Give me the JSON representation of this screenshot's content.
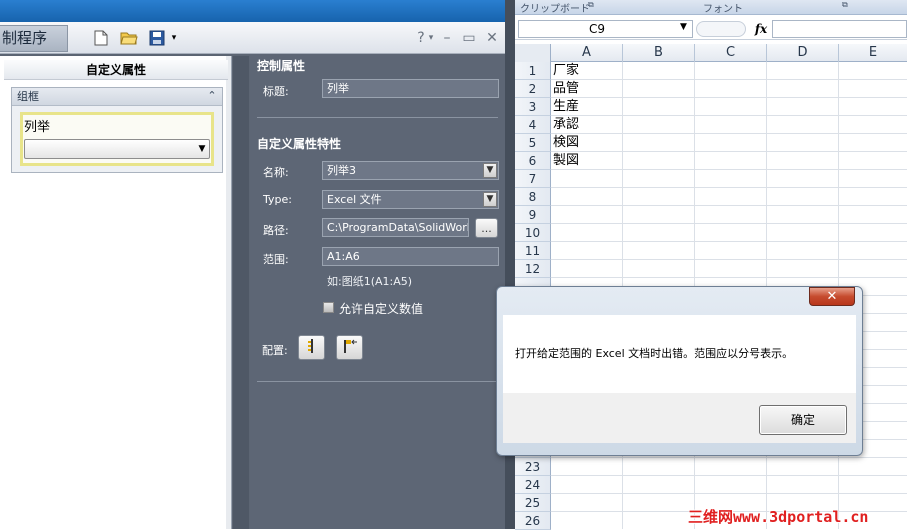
{
  "editor": {
    "app_tab_label": "制程序",
    "designer_title": "自定义属性",
    "group_label": "组框",
    "list_field_label": "列举",
    "help_button": "?",
    "control_section": {
      "title": "控制属性",
      "caption_label": "标题:",
      "caption_value": "列举"
    },
    "property_section": {
      "title": "自定义属性特性",
      "name_label": "名称:",
      "name_value": "列举3",
      "type_label": "Type:",
      "type_value": "Excel 文件",
      "path_label": "路径:",
      "path_value": "C:\\ProgramData\\SolidWorks\\",
      "browse_label": "...",
      "range_label": "范围:",
      "range_value": "A1:A6",
      "range_hint": "如:图纸1(A1:A5)",
      "allow_custom_label": "允许自定义数值",
      "config_label": "配置:"
    }
  },
  "excel": {
    "ribbon_groups": [
      "クリップボード",
      "フォント"
    ],
    "name_box": "C9",
    "fx_label": "fx",
    "columns": [
      "A",
      "B",
      "C",
      "D",
      "E"
    ],
    "rows": [
      "1",
      "2",
      "3",
      "4",
      "5",
      "6",
      "7",
      "8",
      "9",
      "10",
      "11",
      "12",
      "",
      "",
      "",
      "",
      "",
      "",
      "",
      "",
      "",
      "",
      "23",
      "24",
      "25",
      "26"
    ],
    "cells_a": [
      "厂家",
      "品管",
      "生産",
      "承認",
      "検図",
      "製図"
    ]
  },
  "dialog": {
    "close_label": "✕",
    "message": "打开给定范围的 Excel 文档时出错。范围应以分号表示。",
    "ok_label": "确定"
  },
  "watermark": "三维网www.3dportal.cn"
}
